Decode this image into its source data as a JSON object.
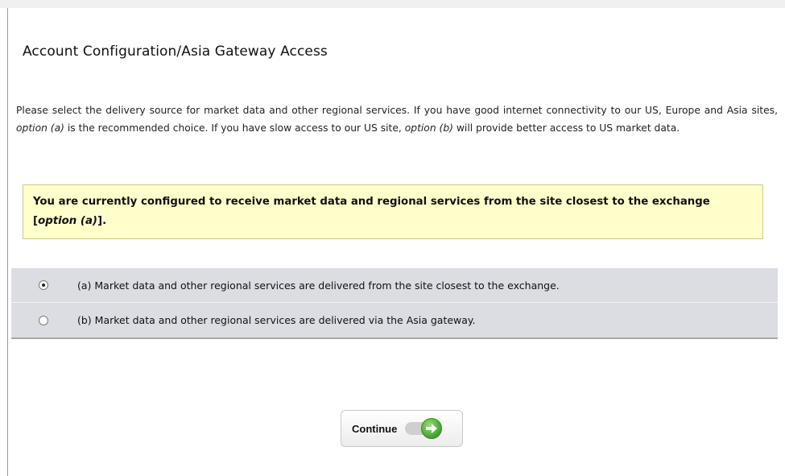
{
  "page": {
    "title": "Account Configuration/Asia Gateway Access",
    "intro": {
      "part1": "Please select the delivery source for market data and other regional services. If you have good internet connectivity to our US, Europe and Asia sites, ",
      "opt_a": "option (a)",
      "part2": " is the recommended choice. If you have slow access to our US site, ",
      "opt_b": "option (b)",
      "part3": " will provide better access to US market data."
    },
    "notice": {
      "text_before": "You are currently configured to receive market data and regional services from the site closest to the exchange [",
      "option": "option (a)",
      "text_after": "]."
    },
    "options": [
      {
        "label": "(a) Market data and other regional services are delivered from the site closest to the exchange.",
        "selected": true
      },
      {
        "label": "(b) Market data and other regional services are delivered via the Asia gateway.",
        "selected": false
      }
    ],
    "continue_button": {
      "label": "Continue",
      "icon": "green-arrow-toggle-icon"
    },
    "colors": {
      "notice_bg": "#ffffcc",
      "option_bg": "#dcdde3",
      "accent_green": "#3ea12a"
    }
  }
}
